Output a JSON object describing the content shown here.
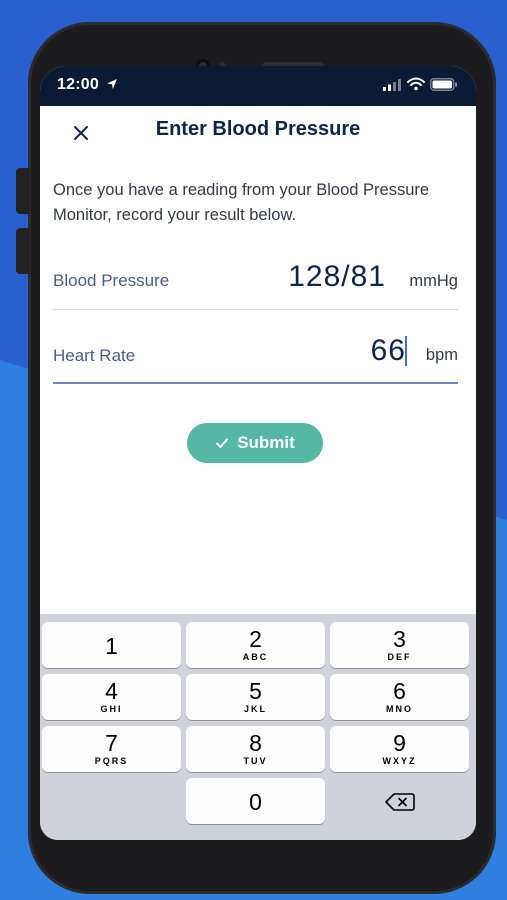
{
  "status_bar": {
    "time": "12:00",
    "icons": [
      "location-arrow-icon",
      "signal-icon",
      "wifi-icon",
      "battery-icon"
    ]
  },
  "header": {
    "title": "Enter Blood Pressure",
    "close_icon": "close-icon"
  },
  "instructions": "Once you have a reading from your Blood Pressure Monitor, record your result below.",
  "fields": {
    "blood_pressure": {
      "label": "Blood Pressure",
      "value": "128/81",
      "unit": "mmHg"
    },
    "heart_rate": {
      "label": "Heart Rate",
      "value": "66",
      "unit": "bpm"
    }
  },
  "submit": {
    "label": "Submit",
    "icon": "check-icon"
  },
  "keypad": {
    "keys": [
      {
        "number": "1",
        "letters": ""
      },
      {
        "number": "2",
        "letters": "ABC"
      },
      {
        "number": "3",
        "letters": "DEF"
      },
      {
        "number": "4",
        "letters": "GHI"
      },
      {
        "number": "5",
        "letters": "JKL"
      },
      {
        "number": "6",
        "letters": "MNO"
      },
      {
        "number": "7",
        "letters": "PQRS"
      },
      {
        "number": "8",
        "letters": "TUV"
      },
      {
        "number": "9",
        "letters": "WXYZ"
      },
      {
        "number": "0",
        "letters": ""
      }
    ],
    "delete_icon": "backspace-icon"
  },
  "colors": {
    "background": "#2f7fe0",
    "title": "#0d2350",
    "label": "#4a5f85",
    "submit": "#55b8a5",
    "status_bar": "#0b1b36",
    "keypad": "#cfd2d8"
  }
}
